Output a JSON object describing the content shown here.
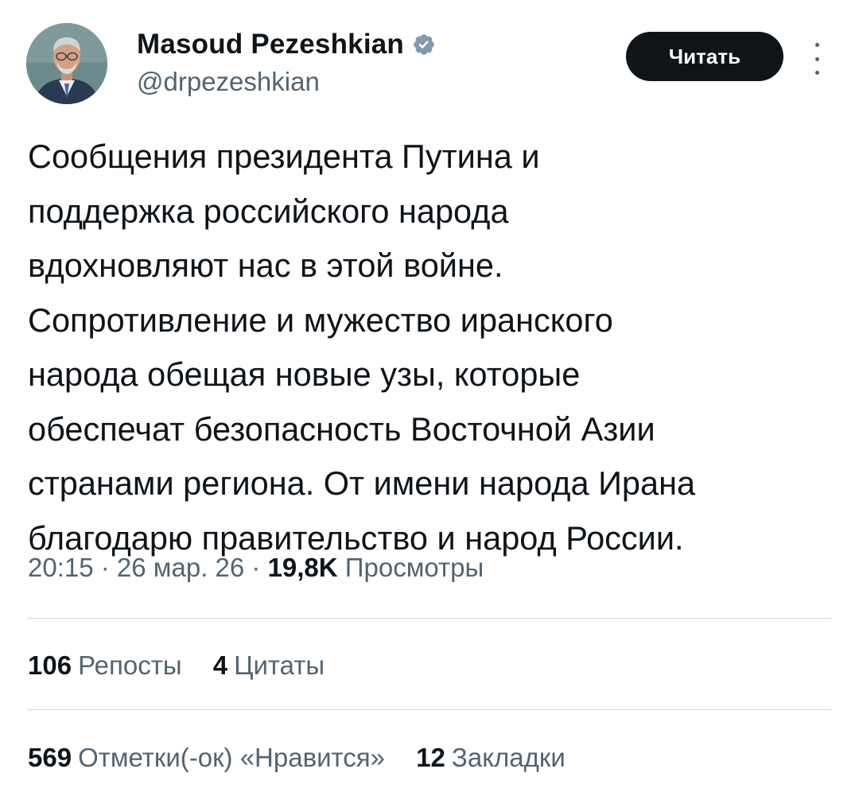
{
  "author": {
    "display_name": "Masoud Pezeshkian",
    "handle": "@drpezeshkian",
    "verified_icon": "verified-badge-icon",
    "badge_color": "#829aab"
  },
  "follow_button": {
    "label": "Читать"
  },
  "more_menu": {
    "icon": "more-vertical-icon"
  },
  "tweet": {
    "lines": [
      "Сообщения президента Путина и",
      "поддержка российского народа",
      "вдохновляют нас в этой войне.",
      "Сопротивление и мужество иранского",
      "народа обещая новые узы, которые",
      "обеспечат безопасность Восточной Азии",
      "странами региона. От имени народа Ирана",
      "благодарю правительство и народ России."
    ]
  },
  "meta": {
    "time": "20:15",
    "separator": " · ",
    "date": "26 мар. 26",
    "views_count": "19,8K",
    "views_label": "Просмотры"
  },
  "stats": {
    "reposts": {
      "count": "106",
      "label": "Репосты"
    },
    "quotes": {
      "count": "4",
      "label": "Цитаты"
    },
    "likes": {
      "count": "569",
      "label": "Отметки(-ок) «Нравится»"
    },
    "bookmarks": {
      "count": "12",
      "label": "Закладки"
    }
  }
}
